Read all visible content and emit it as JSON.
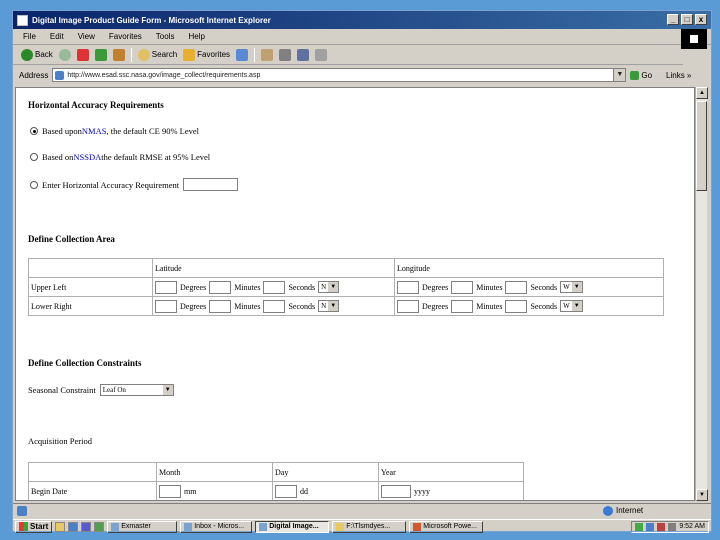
{
  "window": {
    "title": "Digital Image Product Guide Form - Microsoft Internet Explorer",
    "controls": [
      "_",
      "□",
      "x"
    ]
  },
  "menu": [
    "File",
    "Edit",
    "View",
    "Favorites",
    "Tools",
    "Help"
  ],
  "toolbar": {
    "back": "Back",
    "search": "Search",
    "favorites": "Favorites"
  },
  "address": {
    "label": "Address",
    "url": "http://www.esad.ssc.nasa.gov/image_collect/requirements.asp",
    "go": "Go",
    "links": "Links »"
  },
  "horizontal": {
    "heading": "Horizontal Accuracy Requirements",
    "options": [
      {
        "pre": "Based upon ",
        "link": "NMAS",
        "post": ", the default CE 90% Level",
        "selected": true
      },
      {
        "pre": "Based on ",
        "link": "NSSDA",
        "post": " the default RMSE at 95% Level",
        "selected": false
      },
      {
        "pre": "Enter Horizontal Accuracy Requirement",
        "link": "",
        "post": "",
        "selected": false
      }
    ]
  },
  "area": {
    "heading": "Define Collection Area",
    "col_latitude": "Latitude",
    "col_longitude": "Longitude",
    "rows": [
      {
        "label": "Upper Left",
        "degrees": "Degrees",
        "minutes": "Minutes",
        "seconds": "Seconds",
        "lat_dir": "N",
        "lon_dir": "W"
      },
      {
        "label": "Lower Right",
        "degrees": "Degrees",
        "minutes": "Minutes",
        "seconds": "Seconds",
        "lat_dir": "N",
        "lon_dir": "W"
      }
    ]
  },
  "constraints": {
    "heading": "Define Collection Constraints",
    "seasonal_label": "Seasonal Constraint",
    "seasonal_value": "Leaf On",
    "acquisition_label": "Acquisition Period",
    "cols": [
      "Month",
      "Day",
      "Year"
    ],
    "begin_label": "Begin Date",
    "placeholders": [
      "mm",
      "dd",
      "yyyy"
    ]
  },
  "status": {
    "zone": "Internet"
  },
  "taskbar": {
    "start": "Start",
    "tasks": [
      "Exmaster",
      "Inbox - Micros...",
      "Digital Image...",
      "F:\\Tlsmdyes...",
      "Microsoft Powe..."
    ],
    "active_index": 2,
    "clock": "9:52 AM"
  },
  "colors": {
    "titlebar": "#0a246a",
    "link": "#0000cc",
    "chrome": "#d4d0c8",
    "background": "#5b9bd5"
  }
}
